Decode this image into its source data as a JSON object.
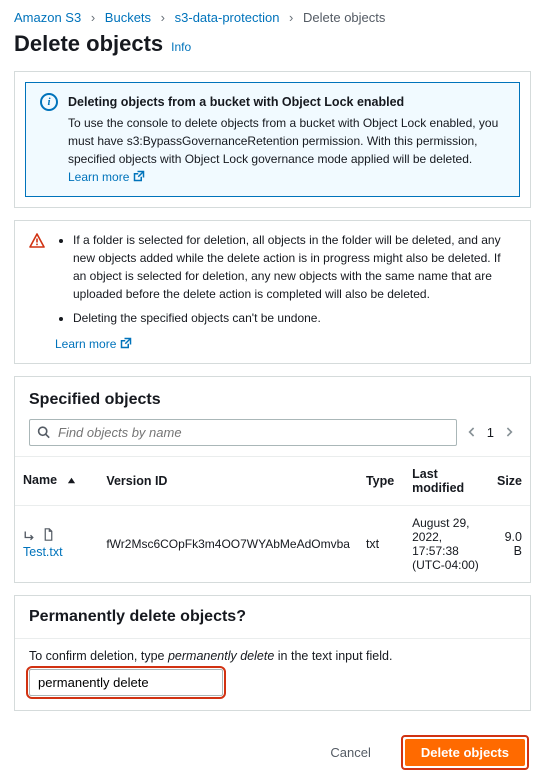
{
  "breadcrumb": {
    "items": [
      "Amazon S3",
      "Buckets",
      "s3-data-protection"
    ],
    "current": "Delete objects"
  },
  "page": {
    "title": "Delete objects",
    "info": "Info"
  },
  "alert": {
    "title": "Deleting objects from a bucket with Object Lock enabled",
    "body": "To use the console to delete objects from a bucket with Object Lock enabled, you must have s3:BypassGovernanceRetention permission. With this permission, specified objects with Object Lock governance mode applied will be deleted.",
    "learn_more": "Learn more"
  },
  "warning": {
    "bullets": [
      "If a folder is selected for deletion, all objects in the folder will be deleted, and any new objects added while the delete action is in progress might also be deleted. If an object is selected for deletion, any new objects with the same name that are uploaded before the delete action is completed will also be deleted.",
      "Deleting the specified objects can't be undone."
    ],
    "learn_more": "Learn more"
  },
  "specified": {
    "title": "Specified objects",
    "search_placeholder": "Find objects by name",
    "page": "1",
    "columns": {
      "name": "Name",
      "version": "Version ID",
      "type": "Type",
      "modified": "Last modified",
      "size": "Size"
    },
    "rows": [
      {
        "name": "Test.txt",
        "version": "fWr2Msc6COpFk3m4OO7WYAbMeAdOmvba",
        "type": "txt",
        "modified": "August 29, 2022, 17:57:38 (UTC-04:00)",
        "size": "9.0 B"
      }
    ]
  },
  "confirm": {
    "title": "Permanently delete objects?",
    "label_pre": "To confirm deletion, type ",
    "label_em": "permanently delete",
    "label_post": " in the text input field.",
    "value": "permanently delete"
  },
  "footer": {
    "cancel": "Cancel",
    "delete": "Delete objects"
  }
}
